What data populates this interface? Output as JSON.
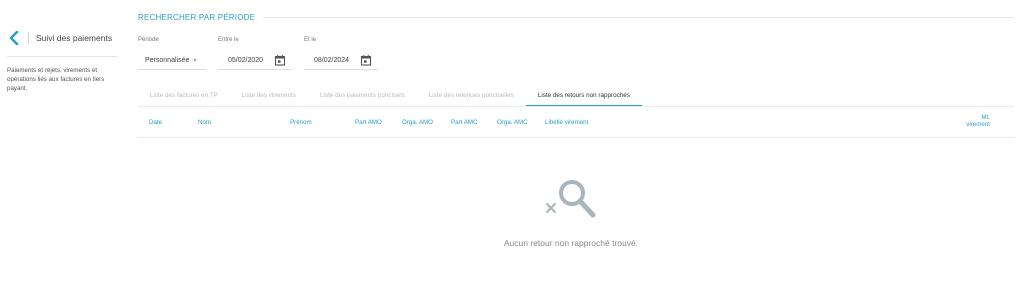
{
  "sidebar": {
    "title": "Suivi des paiements",
    "description": "Paiements et rejets, virements et opérations liés aux factures en tiers payant."
  },
  "section": {
    "title": "RECHERCHER PAR PÉRIODE"
  },
  "filters": {
    "periode_label": "Période",
    "periode_value": "Personnalisée",
    "entre_label": "Entre le",
    "entre_value": "05/02/2020",
    "et_label": "Et le",
    "et_value": "08/02/2024"
  },
  "tabs": [
    {
      "label": "Liste des factures en TP"
    },
    {
      "label": "Liste des virements"
    },
    {
      "label": "Liste des paiements ponctuels"
    },
    {
      "label": "Liste des retenues ponctuelles"
    },
    {
      "label": "Liste des retours non rapprochés",
      "active": true
    }
  ],
  "table": {
    "columns": {
      "date": "Date",
      "nom": "Nom",
      "prenom": "Prénom",
      "part_amo": "Part AMO",
      "orga_amo": "Orga. AMO",
      "part_amc": "Part AMC",
      "orga_amc": "Orga. AMC",
      "libelle": "Libellé virement",
      "mt_line1": "Mt.",
      "mt_line2": "virement"
    }
  },
  "empty_state": {
    "icon": "search-no-result-icon",
    "message": "Aucun retour non rapproché trouvé."
  },
  "colors": {
    "accent": "#2aa1c5",
    "muted_tab": "#b4bcc2",
    "text": "#444444"
  }
}
